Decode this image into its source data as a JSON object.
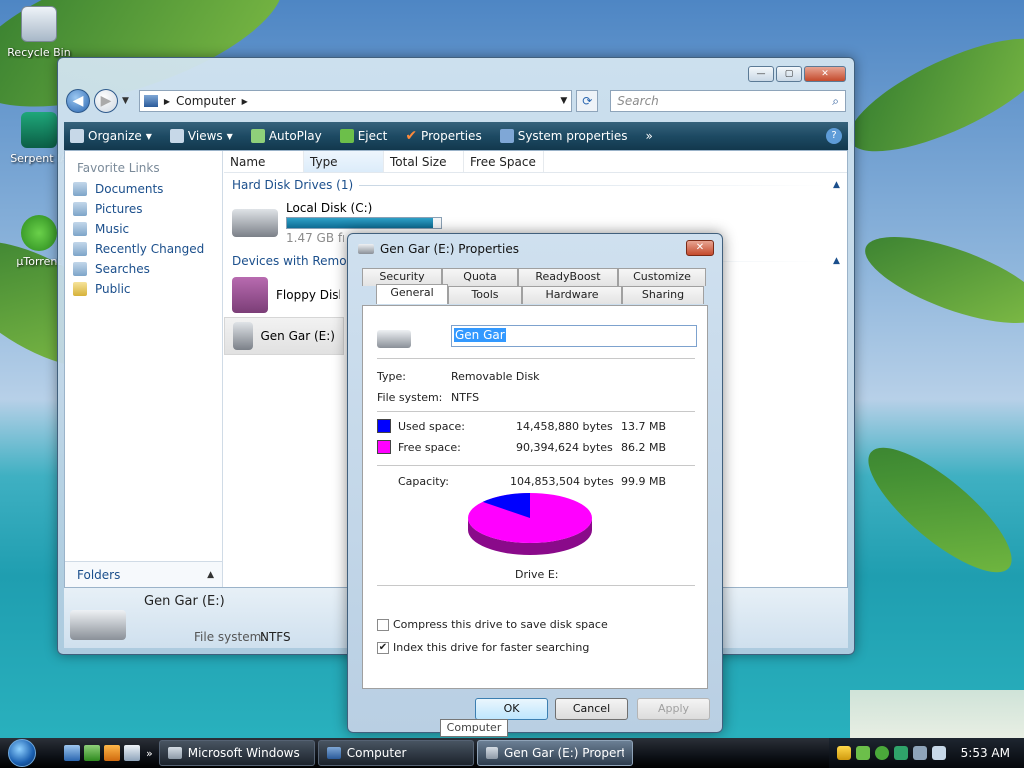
{
  "desktop": {
    "icons": [
      {
        "label": "Recycle Bin",
        "icon": "recycle-bin-icon"
      },
      {
        "label": "Serpent IA",
        "icon": "serpent-icon"
      },
      {
        "label": "µTorrent",
        "icon": "utorrent-icon"
      }
    ]
  },
  "explorer": {
    "address": {
      "location": "Computer"
    },
    "search": {
      "placeholder": "Search"
    },
    "toolbar": {
      "organize": "Organize",
      "views": "Views",
      "autoplay": "AutoPlay",
      "eject": "Eject",
      "properties": "Properties",
      "system_properties": "System properties",
      "more": "»"
    },
    "nav": {
      "favorite_links_title": "Favorite Links",
      "links": [
        "Documents",
        "Pictures",
        "Music",
        "Recently Changed",
        "Searches",
        "Public"
      ],
      "folders_label": "Folders"
    },
    "columns": [
      "Name",
      "Type",
      "Total Size",
      "Free Space"
    ],
    "groups": {
      "hard_disk": "Hard Disk Drives (1)",
      "removable": "Devices with Removable Storage (2)"
    },
    "drives": {
      "local": {
        "name": "Local Disk (C:)",
        "free_text": "1.47 GB free of 30.0 GB",
        "used_fraction": 0.95
      },
      "floppy": {
        "name": "Floppy Disk Drive (A:)"
      },
      "gengar": {
        "name": "Gen Gar (E:)"
      }
    },
    "details": {
      "name": "Gen Gar (E:)",
      "fs_label": "File system:",
      "fs_value": "NTFS"
    }
  },
  "dialog": {
    "title": "Gen Gar (E:) Properties",
    "tabs_top": [
      "Security",
      "Quota",
      "ReadyBoost",
      "Customize"
    ],
    "tabs_bottom": [
      "General",
      "Tools",
      "Hardware",
      "Sharing"
    ],
    "active_tab": "General",
    "name_value": "Gen Gar",
    "type_label": "Type:",
    "type_value": "Removable Disk",
    "fs_label": "File system:",
    "fs_value": "NTFS",
    "used_label": "Used space:",
    "used_bytes": "14,458,880 bytes",
    "used_mb": "13.7 MB",
    "free_label": "Free space:",
    "free_bytes": "90,394,624 bytes",
    "free_mb": "86.2 MB",
    "capacity_label": "Capacity:",
    "capacity_bytes": "104,853,504 bytes",
    "capacity_mb": "99.9 MB",
    "drive_caption": "Drive E:",
    "compress_label": "Compress this drive to save disk space",
    "compress_checked": false,
    "index_label": "Index this drive for faster searching",
    "index_checked": true,
    "ok": "OK",
    "cancel": "Cancel",
    "apply": "Apply",
    "colors": {
      "used": "#0000ff",
      "free": "#ff00ff"
    },
    "used_fraction": 0.138
  },
  "tooltip": "Computer",
  "taskbar": {
    "tasks": [
      "Microsoft Windows",
      "Computer",
      "Gen Gar (E:) Properti..."
    ],
    "more": "»",
    "clock": "5:53 AM"
  }
}
